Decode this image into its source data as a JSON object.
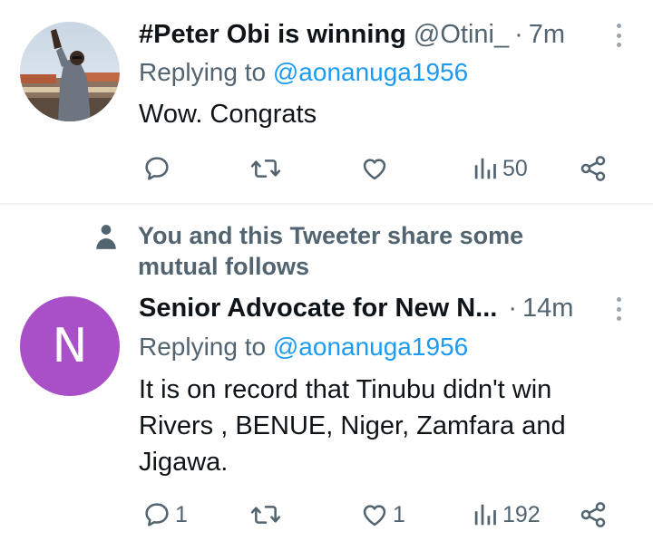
{
  "tweets": [
    {
      "display_name": "#Peter Obi is winning",
      "handle": "@Otini_",
      "separator": "·",
      "time": "7m",
      "replying_prefix": "Replying to ",
      "replying_to": "@aonanuga1956",
      "text": "Wow. Congrats",
      "avatar_icon": "photo-avatar",
      "actions": {
        "reply_count": "",
        "retweet_count": "",
        "like_count": "",
        "views_count": "50"
      }
    },
    {
      "social_context": "You and this Tweeter share some mutual follows",
      "social_icon": "person-icon",
      "display_name": "Senior Advocate for New N...",
      "handle": "",
      "separator": "·",
      "time": "14m",
      "replying_prefix": "Replying to ",
      "replying_to": "@aonanuga1956",
      "text": "It is on record that Tinubu didn't win Rivers , BENUE, Niger, Zamfara and Jigawa.",
      "avatar_letter": "N",
      "avatar_color": "#a94fc8",
      "actions": {
        "reply_count": "1",
        "retweet_count": "",
        "like_count": "1",
        "views_count": "192"
      }
    }
  ],
  "colors": {
    "text_primary": "#0f1419",
    "text_secondary": "#536471",
    "link": "#1d9bf0",
    "divider": "#eff3f4"
  }
}
